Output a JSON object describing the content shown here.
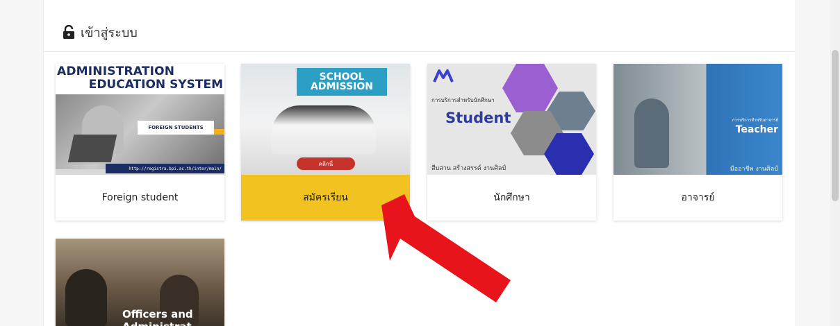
{
  "header": {
    "title": "เข้าสู่ระบบ"
  },
  "cards": [
    {
      "label": "Foreign student",
      "art": {
        "title_line1": "ADMINISTRATION",
        "title_line2": "EDUCATION SYSTEM",
        "tag": "FOREIGN STUDENTS",
        "url": "http://registra.bpi.ac.th/inter/main/"
      }
    },
    {
      "label": "สมัครเรียน",
      "art": {
        "banner_line1": "SCHOOL",
        "banner_line2": "ADMISSION",
        "button": "คลิกนี่"
      }
    },
    {
      "label": "นักศึกษา",
      "art": {
        "small": "การบริการสำหรับนักศึกษา",
        "big": "Student",
        "footer": "สืบสาน สร้างสรรค์ งานศิลป์"
      }
    },
    {
      "label": "อาจารย์",
      "art": {
        "small": "การบริการสำหรับอาจารย์",
        "big": "Teacher",
        "footer": "มืออาชีพ งานศิลป์"
      }
    },
    {
      "label": "",
      "art": {
        "line1": "Officers and",
        "line2": "Administrat"
      }
    }
  ],
  "colors": {
    "highlight": "#f2c220",
    "arrow": "#e8141b",
    "brand_navy": "#1b2c63"
  },
  "icons": {
    "header": "lock-icon",
    "annotation": "red-arrow"
  }
}
